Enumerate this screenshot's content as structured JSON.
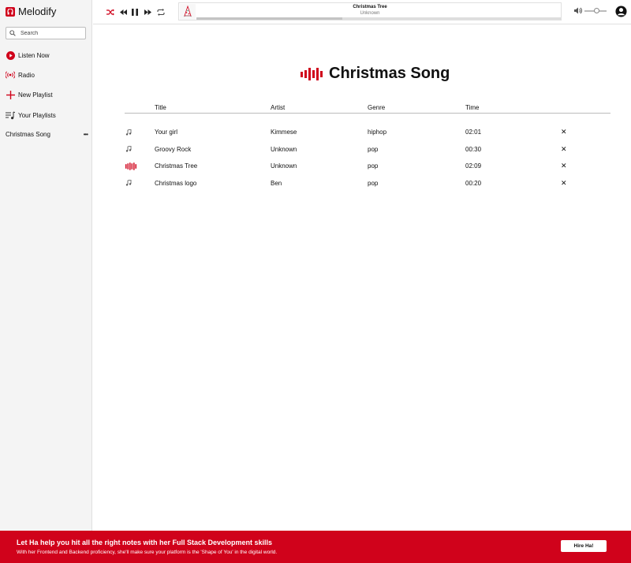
{
  "app": {
    "name": "Melodify"
  },
  "search": {
    "placeholder": "Search"
  },
  "sidebar": {
    "items": [
      {
        "label": "Listen Now",
        "icon": "play-circle-icon"
      },
      {
        "label": "Radio",
        "icon": "radio-icon"
      },
      {
        "label": "New Playlist",
        "icon": "plus-icon"
      },
      {
        "label": "Your Playlists",
        "icon": "playlist-icon"
      }
    ],
    "playlists": [
      {
        "label": "Christmas Song",
        "menu": "•••"
      }
    ]
  },
  "player": {
    "now_playing": {
      "title": "Christmas Tree",
      "artist": "Unknown"
    },
    "progress": 0.4,
    "volume": 0.55
  },
  "main": {
    "title": "Christmas Song",
    "columns": [
      "Title",
      "Artist",
      "Genre",
      "Time"
    ],
    "rows": [
      {
        "title": "Your girl",
        "artist": "Kimmese",
        "genre": "hiphop",
        "time": "02:01",
        "playing": false
      },
      {
        "title": "Groovy Rock",
        "artist": "Unknown",
        "genre": "pop",
        "time": "00:30",
        "playing": false
      },
      {
        "title": "Christmas Tree",
        "artist": "Unknown",
        "genre": "pop",
        "time": "02:09",
        "playing": true
      },
      {
        "title": "Christmas logo",
        "artist": "Ben",
        "genre": "pop",
        "time": "00:20",
        "playing": false
      }
    ],
    "delete_glyph": "✕"
  },
  "banner": {
    "title": "Let Ha help you hit all the right notes with her Full Stack Development skills",
    "subtitle": "With her Frontend and Backend proficiency, she'll make sure your platform is the 'Shape of You' in the digital world.",
    "button": "Hire Ha!"
  },
  "colors": {
    "accent": "#d0021b",
    "sidebar_bg": "#f4f4f4"
  }
}
